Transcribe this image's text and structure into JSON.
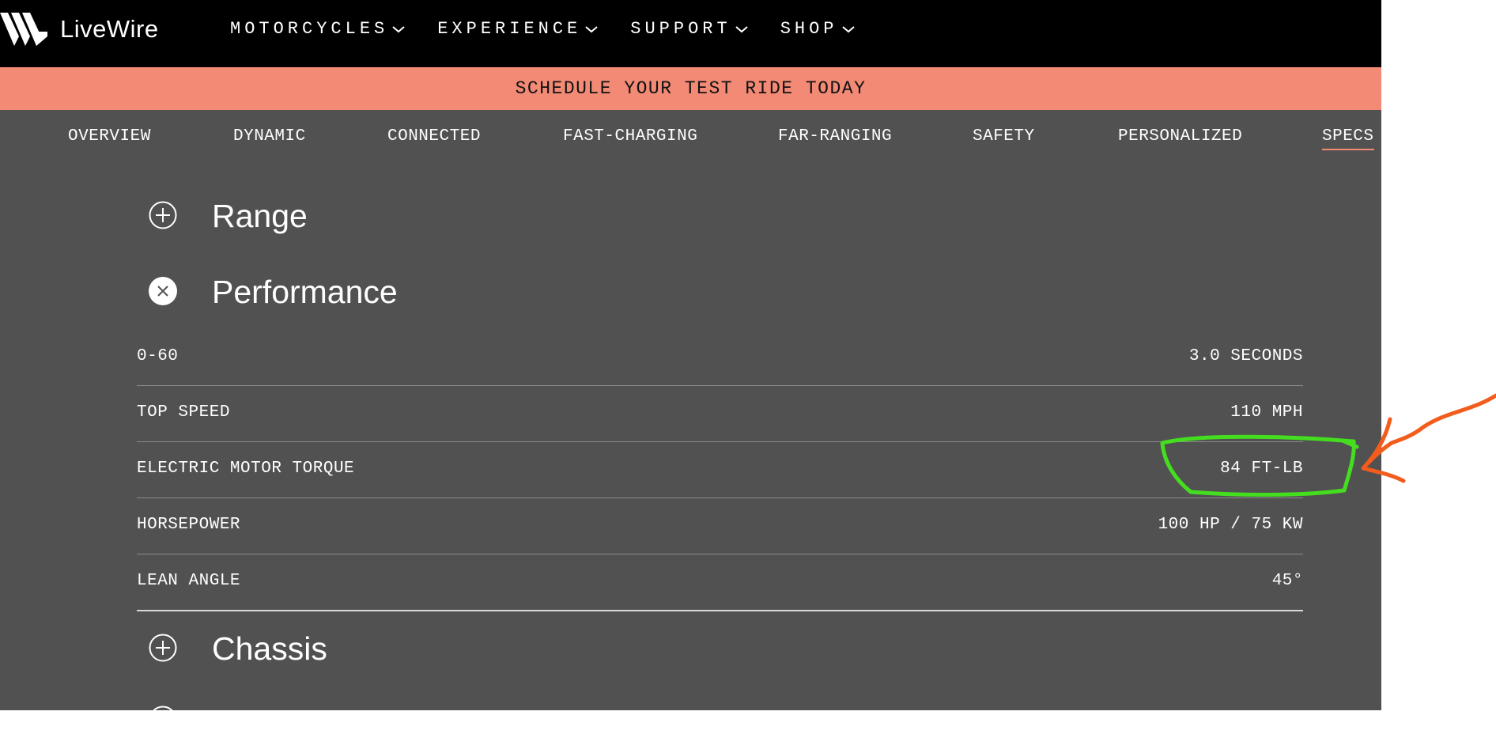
{
  "brand": {
    "name": "LiveWire"
  },
  "top_nav": {
    "items": [
      {
        "label": "MOTORCYCLES"
      },
      {
        "label": "EXPERIENCE"
      },
      {
        "label": "SUPPORT"
      },
      {
        "label": "SHOP"
      }
    ]
  },
  "banner": {
    "text": "SCHEDULE YOUR TEST RIDE TODAY"
  },
  "sub_nav": {
    "items": [
      {
        "label": "OVERVIEW"
      },
      {
        "label": "DYNAMIC"
      },
      {
        "label": "CONNECTED"
      },
      {
        "label": "FAST-CHARGING"
      },
      {
        "label": "FAR-RANGING"
      },
      {
        "label": "SAFETY"
      },
      {
        "label": "PERSONALIZED"
      },
      {
        "label": "SPECS",
        "active": true
      }
    ]
  },
  "sections": {
    "range": {
      "title": "Range",
      "expanded": false
    },
    "performance": {
      "title": "Performance",
      "expanded": true,
      "rows": [
        {
          "label": "0-60",
          "value": "3.0 SECONDS"
        },
        {
          "label": "TOP SPEED",
          "value": "110 MPH"
        },
        {
          "label": "ELECTRIC MOTOR TORQUE",
          "value": "84 FT-LB"
        },
        {
          "label": "HORSEPOWER",
          "value": "100 HP / 75 KW"
        },
        {
          "label": "LEAN ANGLE",
          "value": "45°"
        }
      ]
    },
    "chassis": {
      "title": "Chassis",
      "expanded": false
    }
  },
  "colors": {
    "nav_bg": "#000000",
    "banner_bg": "#f28a75",
    "page_bg": "#515151",
    "active_underline": "#f28a75",
    "highlight_circle": "#44dd1f",
    "annotation_arrow": "#f25c1c"
  }
}
